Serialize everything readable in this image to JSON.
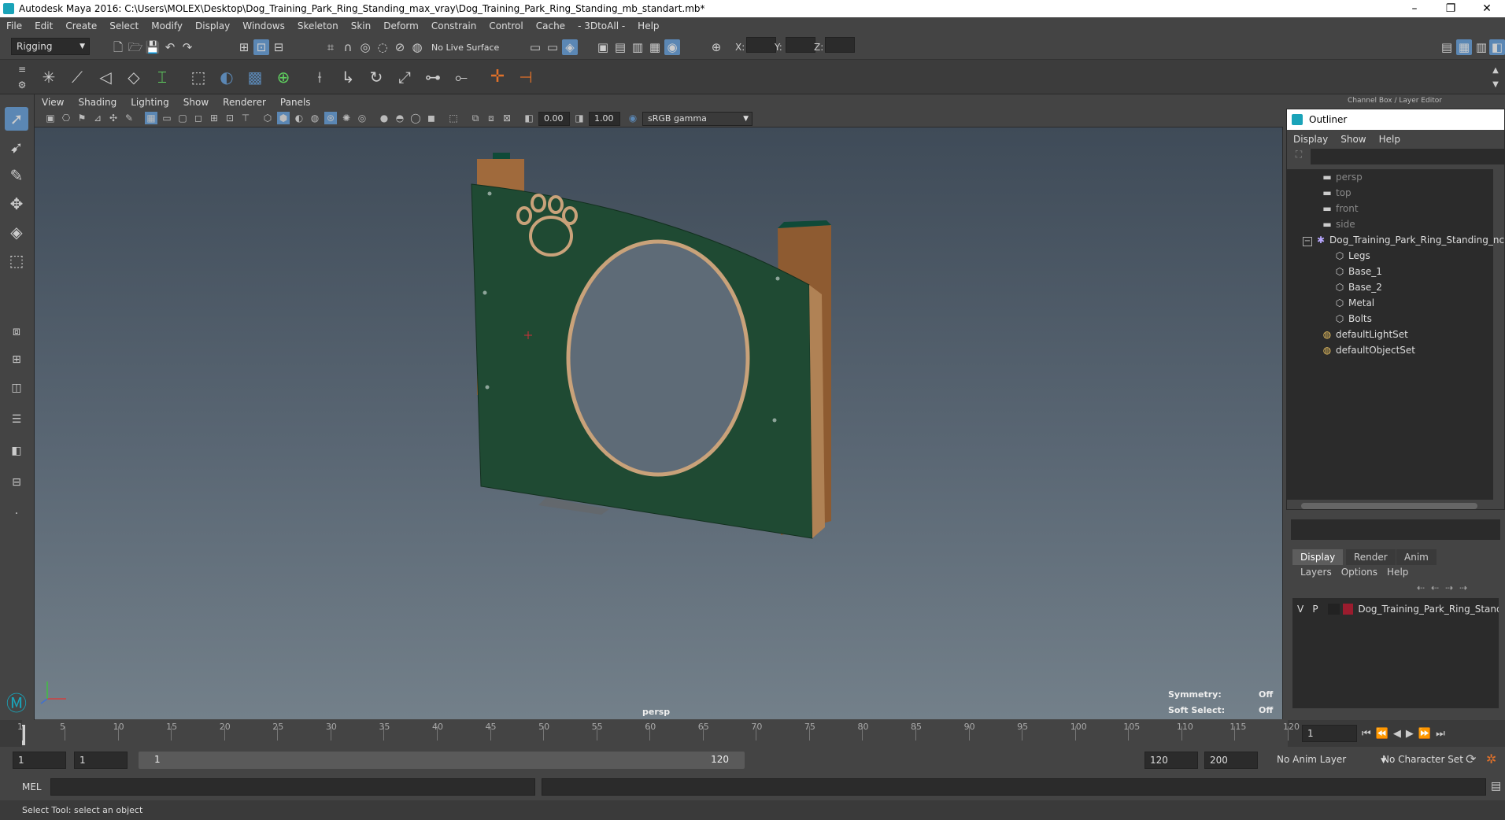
{
  "window": {
    "title": "Autodesk Maya 2016: C:\\Users\\MOLEX\\Desktop\\Dog_Training_Park_Ring_Standing_max_vray\\Dog_Training_Park_Ring_Standing_mb_standart.mb*",
    "minimize": "–",
    "maximize": "❐",
    "close": "✕"
  },
  "menubar": [
    "File",
    "Edit",
    "Create",
    "Select",
    "Modify",
    "Display",
    "Windows",
    "Skeleton",
    "Skin",
    "Deform",
    "Constrain",
    "Control",
    "Cache",
    "- 3DtoAll -",
    "Help"
  ],
  "shelf": {
    "mode": "Rigging",
    "live_surface": "No Live Surface",
    "x_label": "X:",
    "y_label": "Y:",
    "z_label": "Z:"
  },
  "viewport_menu": [
    "View",
    "Shading",
    "Lighting",
    "Show",
    "Renderer",
    "Panels"
  ],
  "viewport_toolbar": {
    "exposure": "0.00",
    "gamma": "1.00",
    "color_space": "sRGB gamma"
  },
  "viewport": {
    "camera": "persp",
    "symmetry_label": "Symmetry:",
    "symmetry_value": "Off",
    "soft_select_label": "Soft Select:",
    "soft_select_value": "Off"
  },
  "channel_box": {
    "title": "Channel Box / Layer Editor"
  },
  "outliner": {
    "title": "Outliner",
    "menu": [
      "Display",
      "Show",
      "Help"
    ],
    "items": [
      {
        "label": "persp",
        "icon": "camera-icon",
        "dim": true
      },
      {
        "label": "top",
        "icon": "camera-icon",
        "dim": true
      },
      {
        "label": "front",
        "icon": "camera-icon",
        "dim": true
      },
      {
        "label": "side",
        "icon": "camera-icon",
        "dim": true
      },
      {
        "label": "Dog_Training_Park_Ring_Standing_ncl",
        "icon": "group-icon",
        "dim": false
      },
      {
        "label": "Legs",
        "icon": "mesh-icon",
        "dim": false
      },
      {
        "label": "Base_1",
        "icon": "mesh-icon",
        "dim": false
      },
      {
        "label": "Base_2",
        "icon": "mesh-icon",
        "dim": false
      },
      {
        "label": "Metal",
        "icon": "mesh-icon",
        "dim": false
      },
      {
        "label": "Bolts",
        "icon": "mesh-icon",
        "dim": false
      },
      {
        "label": "defaultLightSet",
        "icon": "set-icon",
        "dim": false
      },
      {
        "label": "defaultObjectSet",
        "icon": "set-icon",
        "dim": false
      }
    ]
  },
  "layer_editor": {
    "tabs": [
      "Display",
      "Render",
      "Anim"
    ],
    "menu": [
      "Layers",
      "Options",
      "Help"
    ],
    "layer": {
      "v": "V",
      "p": "P",
      "name": "Dog_Training_Park_Ring_Standi",
      "color": "#9b1c2e"
    }
  },
  "timeline": {
    "ticks": [
      1,
      5,
      10,
      15,
      20,
      25,
      30,
      35,
      40,
      45,
      50,
      55,
      60,
      65,
      70,
      75,
      80,
      85,
      90,
      95,
      100,
      105,
      110,
      115,
      120
    ],
    "current_frame": "1"
  },
  "range": {
    "start": "1",
    "playback_start": "1",
    "slider_start": "1",
    "slider_end": "120",
    "playback_end": "120",
    "end": "200",
    "anim_layer": "No Anim Layer",
    "character_set": "No Character Set"
  },
  "mel": {
    "label": "MEL"
  },
  "status": {
    "text": "Select Tool: select an object"
  },
  "colors": {
    "accent": "#5b87b4",
    "board": "#1f4a33",
    "post": "#a06a3c"
  }
}
